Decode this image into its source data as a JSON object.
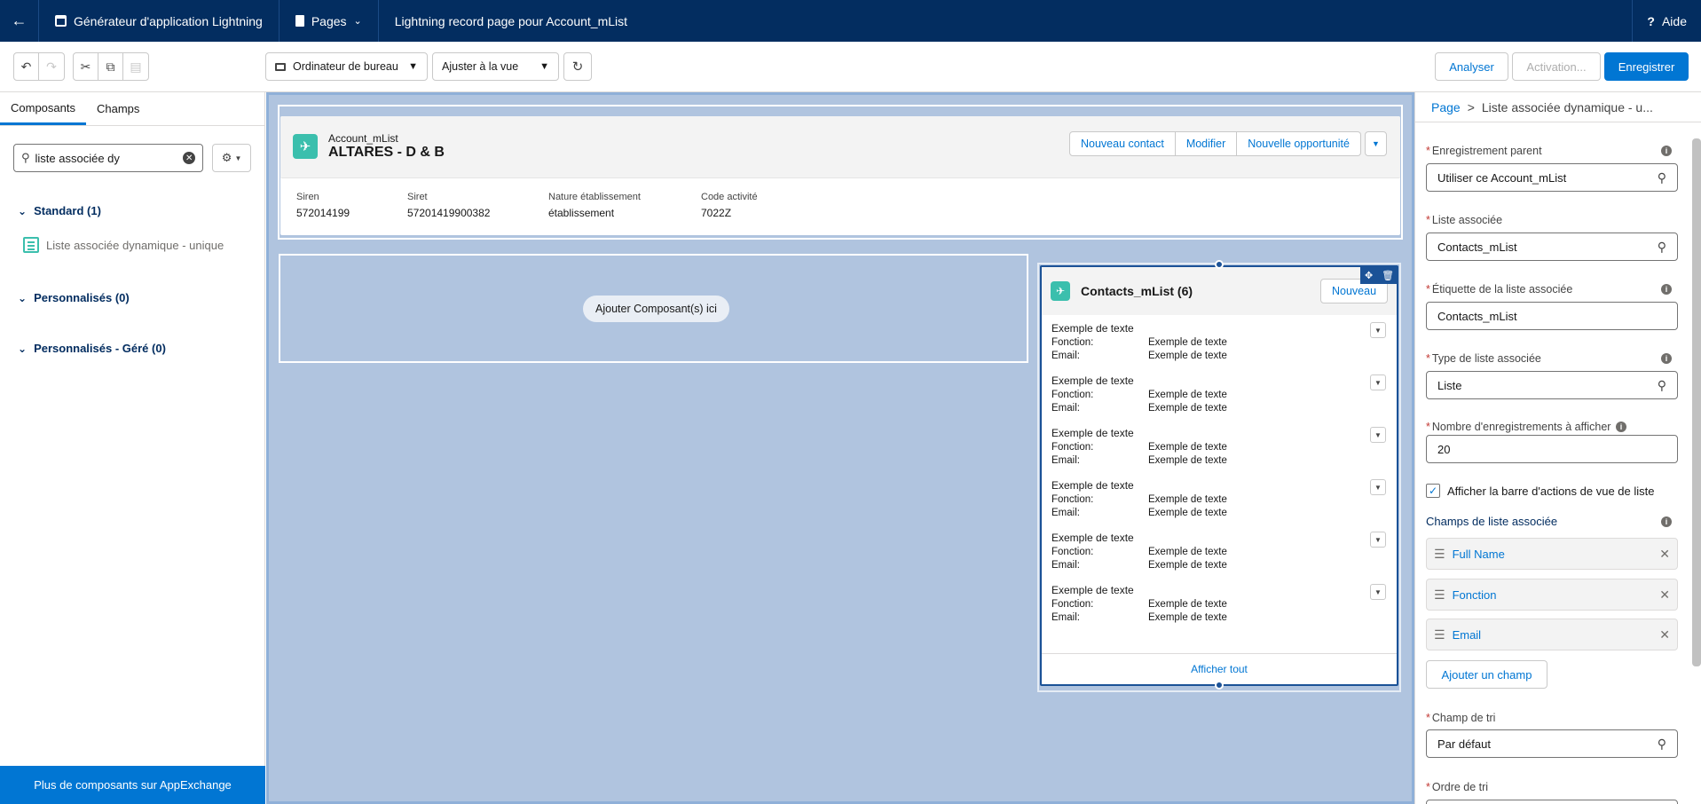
{
  "topbar": {
    "app_name": "Générateur d'application Lightning",
    "pages_label": "Pages",
    "record_page_title": "Lightning record page pour Account_mList",
    "help_label": "Aide"
  },
  "toolbar": {
    "device_select": "Ordinateur de bureau",
    "zoom_select": "Ajuster à la vue",
    "analyze_label": "Analyser",
    "activation_label": "Activation...",
    "save_label": "Enregistrer"
  },
  "left_panel": {
    "tabs": [
      "Composants",
      "Champs"
    ],
    "search_value": "liste associée dy",
    "sections": [
      {
        "title": "Standard (1)",
        "items": [
          "Liste associée dynamique - unique"
        ]
      },
      {
        "title": "Personnalisés (0)",
        "items": []
      },
      {
        "title": "Personnalisés - Géré (0)",
        "items": []
      }
    ],
    "appexchange_label": "Plus de composants sur AppExchange"
  },
  "highlights": {
    "object_label": "Account_mList",
    "record_name": "ALTARES - D & B",
    "actions": [
      "Nouveau contact",
      "Modifier",
      "Nouvelle opportunité"
    ],
    "fields": [
      {
        "label": "Siren",
        "value": "572014199"
      },
      {
        "label": "Siret",
        "value": "57201419900382"
      },
      {
        "label": "Nature établissement",
        "value": "établissement"
      },
      {
        "label": "Code activité",
        "value": "7022Z"
      }
    ]
  },
  "empty_region": {
    "add_label": "Ajouter Composant(s) ici"
  },
  "related_list": {
    "title": "Contacts_mList (6)",
    "new_label": "Nouveau",
    "rows": [
      {
        "title": "Exemple de texte",
        "f1_label": "Fonction:",
        "f1_value": "Exemple de texte",
        "f2_label": "Email:",
        "f2_value": "Exemple de texte"
      },
      {
        "title": "Exemple de texte",
        "f1_label": "Fonction:",
        "f1_value": "Exemple de texte",
        "f2_label": "Email:",
        "f2_value": "Exemple de texte"
      },
      {
        "title": "Exemple de texte",
        "f1_label": "Fonction:",
        "f1_value": "Exemple de texte",
        "f2_label": "Email:",
        "f2_value": "Exemple de texte"
      },
      {
        "title": "Exemple de texte",
        "f1_label": "Fonction:",
        "f1_value": "Exemple de texte",
        "f2_label": "Email:",
        "f2_value": "Exemple de texte"
      },
      {
        "title": "Exemple de texte",
        "f1_label": "Fonction:",
        "f1_value": "Exemple de texte",
        "f2_label": "Email:",
        "f2_value": "Exemple de texte"
      },
      {
        "title": "Exemple de texte",
        "f1_label": "Fonction:",
        "f1_value": "Exemple de texte",
        "f2_label": "Email:",
        "f2_value": "Exemple de texte"
      }
    ],
    "view_all_label": "Afficher tout"
  },
  "right_panel": {
    "breadcrumb_root": "Page",
    "breadcrumb_sep": ">",
    "breadcrumb_current": "Liste associée dynamique - u...",
    "parent_record_label": "Enregistrement parent",
    "parent_record_value": "Utiliser ce Account_mList",
    "related_list_label": "Liste associée",
    "related_list_value": "Contacts_mList",
    "related_list_title_label": "Étiquette de la liste associée",
    "related_list_title_value": "Contacts_mList",
    "related_list_type_label": "Type de liste associée",
    "related_list_type_value": "Liste",
    "record_count_label": "Nombre d'enregistrements à afficher",
    "record_count_value": "20",
    "show_actions_label": "Afficher la barre d'actions de vue de liste",
    "fields_label": "Champs de liste associée",
    "fields": [
      "Full Name",
      "Fonction",
      "Email"
    ],
    "add_field_label": "Ajouter un champ",
    "sort_field_label": "Champ de tri",
    "sort_field_value": "Par défaut",
    "sort_order_label": "Ordre de tri"
  },
  "colors": {
    "nav": "#032d60",
    "brand": "#0176d3",
    "canvas": "#b0c4df",
    "object_icon": "#3bbfad"
  }
}
